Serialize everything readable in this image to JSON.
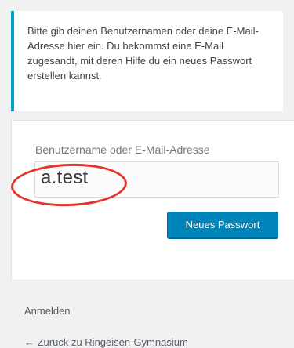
{
  "message": {
    "text": "Bitte gib deinen Benutzernamen oder deine E-Mail-Adresse hier ein. Du bekommst eine E-Mail zugesandt, mit deren Hilfe du ein neues Passwort erstellen kannst."
  },
  "form": {
    "label": "Benutzername oder E-Mail-Adresse",
    "input_value": "a.test",
    "submit_label": "Neues Passwort"
  },
  "links": {
    "login": "Anmelden",
    "back": "← Zurück zu Ringeisen-Gymnasium"
  },
  "colors": {
    "accent": "#00a0d2",
    "button": "#0085ba",
    "annotation": "#e3342f"
  }
}
